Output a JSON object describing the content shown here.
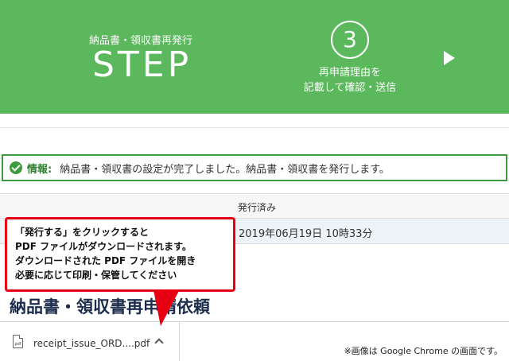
{
  "banner": {
    "subtitle": "納品書・領収書再発行",
    "step_word": "STEP",
    "step_number": "3",
    "step_desc_line1": "再申請理由を",
    "step_desc_line2": "記載して確認・送信"
  },
  "info": {
    "label": "情報:",
    "message": "納品書・領収書の設定が完了しました。納品書・領収書を発行します。"
  },
  "table": {
    "header": "発行済み",
    "value": "2019年06月19日 10時33分"
  },
  "callout": {
    "line1": "「発行する」をクリックすると",
    "line2": "PDF ファイルがダウンロードされます。",
    "line3": "ダウンロードされた PDF ファイルを開き",
    "line4": "必要に応じて印刷・保管してください"
  },
  "heading": "納品書・領収書再申請依頼",
  "download": {
    "file_name": "receipt_issue_ORD....pdf",
    "icon_label": "pdf",
    "note": "※画像は Google Chrome の画面です。"
  },
  "colors": {
    "banner_green": "#5cb85c",
    "info_border": "#3d9a3d",
    "callout_red": "#e60012"
  }
}
